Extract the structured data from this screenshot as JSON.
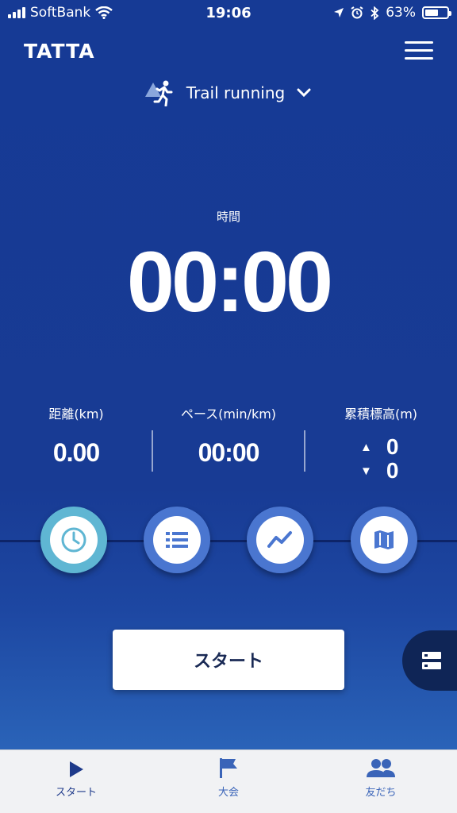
{
  "status_bar": {
    "carrier": "SoftBank",
    "time": "19:06",
    "battery_percent": "63%",
    "battery_level": 0.63
  },
  "header": {
    "logo": "TATTA",
    "activity_label": "Trail running"
  },
  "timer": {
    "label": "時間",
    "value": "00:00"
  },
  "stats": {
    "distance_label": "距離(km)",
    "distance_value": "0.00",
    "pace_label": "ペース(min/km)",
    "pace_value": "00:00",
    "elevation_label": "累積標高(m)",
    "elevation_up": "0",
    "elevation_down": "0",
    "up_symbol": "▲",
    "down_symbol": "▼"
  },
  "start_button": "スタート",
  "tabs": [
    {
      "label": "スタート",
      "color": "#1e3a8a"
    },
    {
      "label": "大会",
      "color": "#3a64b8"
    },
    {
      "label": "友だち",
      "color": "#3a64b8"
    }
  ],
  "colors": {
    "background": "#183b94",
    "accent_teal": "#5fb6d3",
    "accent_blue": "#4a76d0",
    "tab_active": "#1e3a8a"
  },
  "icons": {
    "activity": "trail-runner-icon",
    "chevron": "chevron-down-icon",
    "menu": "hamburger-menu-icon",
    "circle_buttons": [
      "clock-icon",
      "list-icon",
      "chart-line-icon",
      "map-icon"
    ],
    "side_tab": "split-view-icon"
  }
}
